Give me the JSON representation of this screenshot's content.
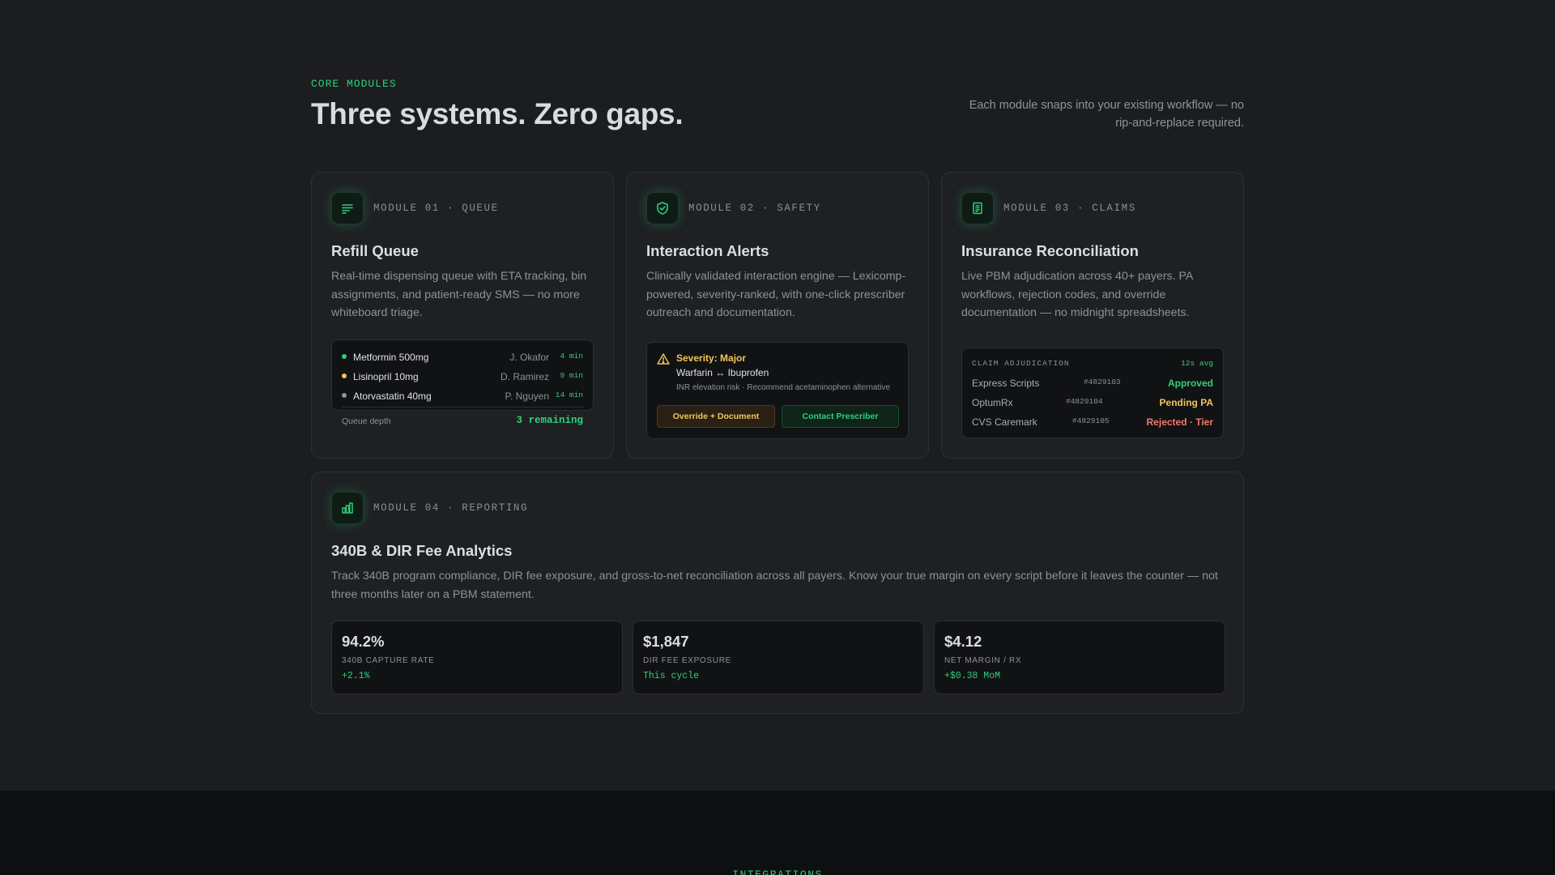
{
  "header": {
    "eyebrow": "CORE MODULES",
    "title": "Three systems. Zero gaps.",
    "lede": "Each module snaps into your existing workflow — no rip-and-replace required."
  },
  "modules": [
    {
      "label": "MODULE 01 · QUEUE",
      "icon": "list-lines-icon",
      "title": "Refill Queue",
      "description": "Real-time dispensing queue with ETA tracking, bin assignments, and patient-ready SMS — no more whiteboard triage.",
      "queue": {
        "rows": [
          {
            "drug": "Metformin 500mg",
            "patient": "J. Okafor",
            "eta": "4 min",
            "dot_color": "#2fd07a"
          },
          {
            "drug": "Lisinopril 10mg",
            "patient": "D. Ramirez",
            "eta": "9 min",
            "dot_color": "#f2c55c"
          },
          {
            "drug": "Atorvastatin 40mg",
            "patient": "P. Nguyen",
            "eta": "14 min",
            "dot_color": "#8d9298"
          }
        ],
        "footer_label": "Queue depth",
        "footer_value": "3 remaining"
      }
    },
    {
      "label": "MODULE 02 · SAFETY",
      "icon": "shield-check-icon",
      "title": "Interaction Alerts",
      "description": "Clinically validated interaction engine — Lexicomp-powered, severity-ranked, with one-click prescriber outreach and documentation.",
      "alert": {
        "severity": "Severity: Major",
        "pair": "Warfarin ↔ Ibuprofen",
        "note": "INR elevation risk · Recommend acetaminophen alternative",
        "primary_button": "Override + Document",
        "secondary_button": "Contact Prescriber"
      }
    },
    {
      "label": "MODULE 03 · CLAIMS",
      "icon": "receipt-icon",
      "title": "Insurance Reconciliation",
      "description": "Live PBM adjudication across 40+ payers. PA workflows, rejection codes, and override documentation — no midnight spreadsheets.",
      "claims": {
        "header": "CLAIM ADJUDICATION",
        "avg": "12s avg",
        "rows": [
          {
            "payer": "Express Scripts",
            "id": "#4829103",
            "status": "Approved",
            "status_color": "#2fd07a"
          },
          {
            "payer": "OptumRx",
            "id": "#4829104",
            "status": "Pending PA",
            "status_color": "#f2c55c"
          },
          {
            "payer": "CVS Caremark",
            "id": "#4829105",
            "status": "Rejected · Tier",
            "status_color": "#f07a6a"
          }
        ]
      }
    }
  ],
  "reporting": {
    "label": "MODULE 04 · REPORTING",
    "icon": "bar-chart-icon",
    "title": "340B & DIR Fee Analytics",
    "description": "Track 340B program compliance, DIR fee exposure, and gross-to-net reconciliation across all payers. Know your true margin on every script before it leaves the counter — not three months later on a PBM statement.",
    "stats": [
      {
        "value": "94.2%",
        "label": "340B CAPTURE RATE",
        "delta": "+2.1%"
      },
      {
        "value": "$1,847",
        "label": "DIR FEE EXPOSURE",
        "delta": "This cycle"
      },
      {
        "value": "$4.12",
        "label": "NET MARGIN / RX",
        "delta": "+$0.38 MoM"
      }
    ]
  },
  "footer": {
    "eyebrow": "INTEGRATIONS"
  },
  "colors": {
    "accent": "#2fd07a",
    "warning": "#f2c55c",
    "danger": "#f07a6a",
    "background": "#1b1d20"
  }
}
